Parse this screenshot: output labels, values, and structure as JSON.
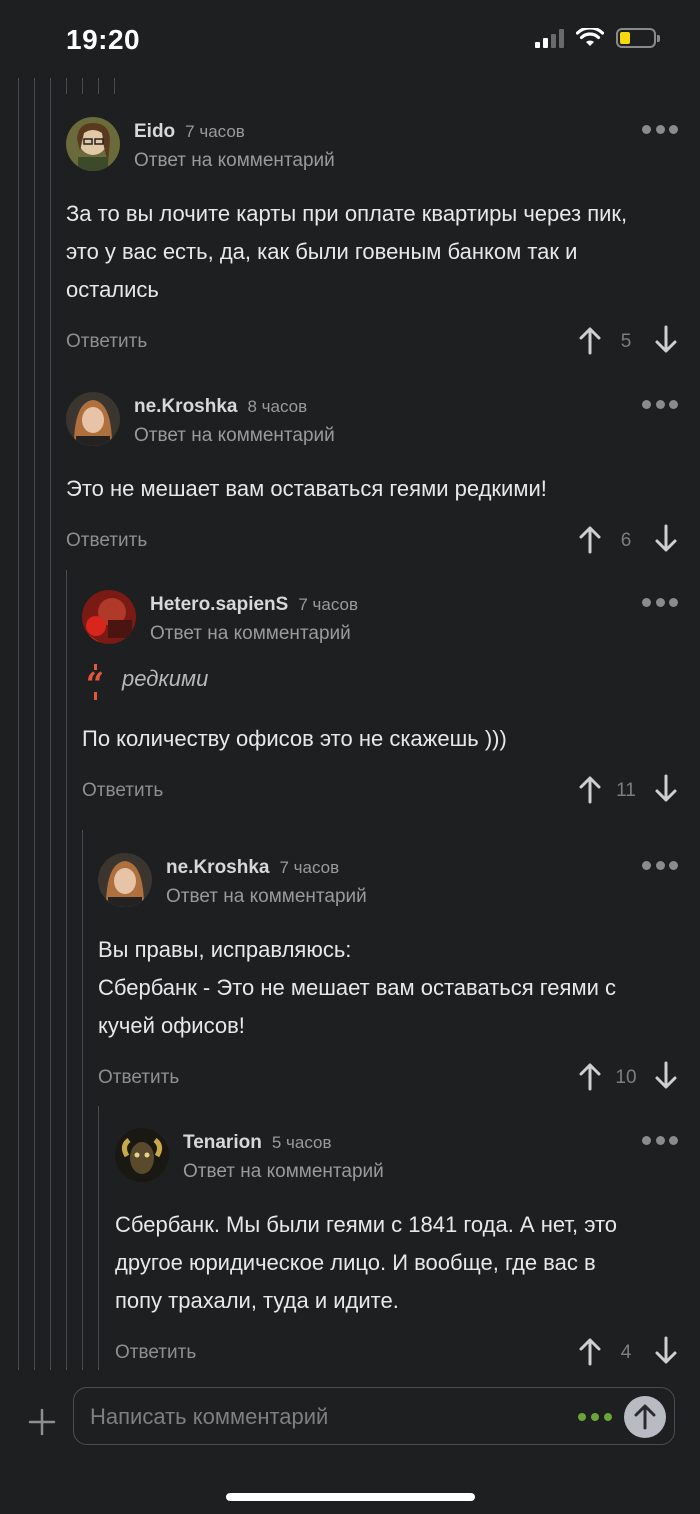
{
  "status": {
    "time": "19:20"
  },
  "comments": [
    {
      "author": "Eido",
      "time": "7 часов",
      "sub": "Ответ на комментарий",
      "lines": [
        "За то вы лочите карты при оплате квартиры через пик,",
        "это у вас есть, да, как были говеным банком так и",
        "остались"
      ],
      "reply": "Ответить",
      "score": "5"
    },
    {
      "author": "ne.Kroshka",
      "time": "8 часов",
      "sub": "Ответ на комментарий",
      "lines": [
        "Это не мешает вам оставаться геями редкими!"
      ],
      "reply": "Ответить",
      "score": "6"
    },
    {
      "author": "Hetero.sapienS",
      "time": "7 часов",
      "sub": "Ответ на комментарий",
      "quote": "редкими",
      "lines": [
        "По количеству офисов это не скажешь )))"
      ],
      "reply": "Ответить",
      "score": "11"
    },
    {
      "author": "ne.Kroshka",
      "time": "7 часов",
      "sub": "Ответ на комментарий",
      "lines": [
        "Вы правы, исправляюсь:",
        "Сбербанк - Это не мешает вам оставаться геями с",
        "кучей офисов!"
      ],
      "reply": "Ответить",
      "score": "10"
    },
    {
      "author": "Tenarion",
      "time": "5 часов",
      "sub": "Ответ на комментарий",
      "lines": [
        "Сбербанк. Мы были геями с 1841 года. А нет, это",
        "другое юридическое лицо. И вообще, где вас в",
        "попу трахали, туда и идите."
      ],
      "reply": "Ответить",
      "score": "4"
    }
  ],
  "composer": {
    "placeholder": "Написать комментарий"
  }
}
